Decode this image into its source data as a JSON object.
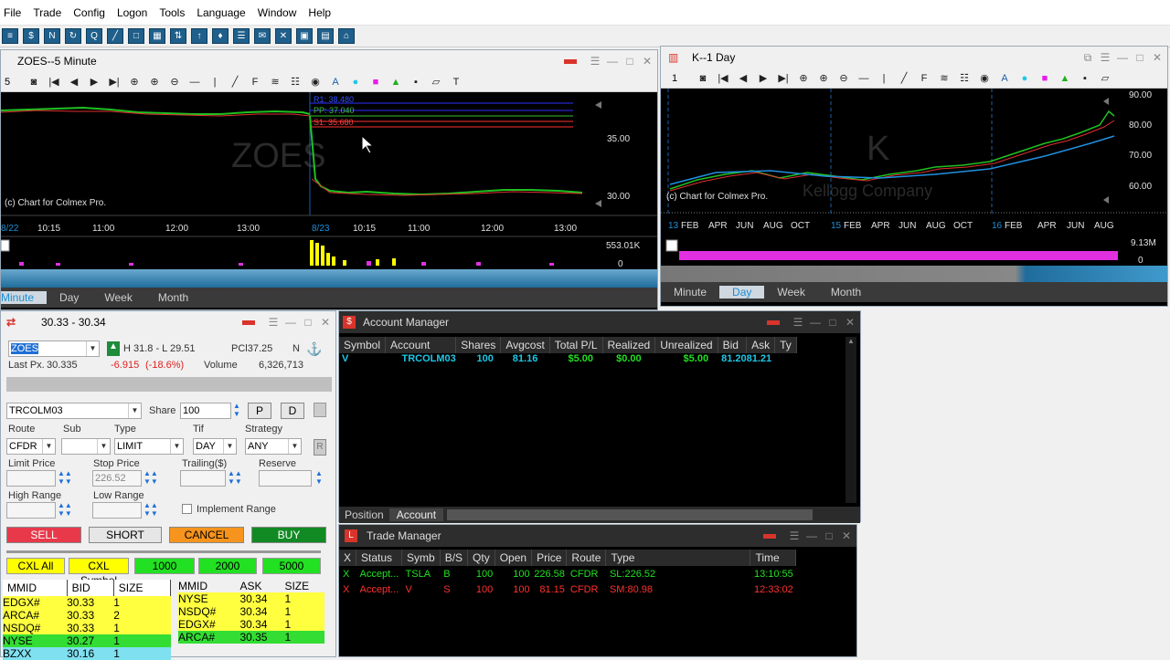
{
  "menu": [
    "File",
    "Trade",
    "Config",
    "Logon",
    "Tools",
    "Language",
    "Window",
    "Help"
  ],
  "toolbar_icons": [
    "layout-icon",
    "dollar-icon",
    "news-icon",
    "refresh-icon",
    "quote-icon",
    "chart-icon",
    "window-icon",
    "grid-icon",
    "sort-icon",
    "upload-icon",
    "alert-icon",
    "list-icon",
    "mail-icon",
    "cross-icon",
    "scan-icon",
    "book-icon",
    "home-icon"
  ],
  "zoes_chart": {
    "title": "ZOES--5 Minute",
    "period_value": "5",
    "watermark": "ZOES",
    "copyright": "(c) Chart for Colmex Pro.",
    "price_ticks": [
      "35.00",
      "30.00"
    ],
    "vol_ticks": [
      "553.01K",
      "0"
    ],
    "lines": [
      "R1: 38.480",
      "PP: 37.040",
      "S1: 35.680"
    ],
    "time_labels": [
      "8/22",
      "10:15",
      "11:00",
      "12:00",
      "13:00",
      "8/23",
      "10:15",
      "11:00",
      "12:00",
      "13:00"
    ],
    "tabs": [
      "Minute",
      "Day",
      "Week",
      "Month"
    ],
    "active_tab": "Minute"
  },
  "k_chart": {
    "title": "K--1 Day",
    "period_value": "1",
    "watermark": "K",
    "company": "Kellogg Company",
    "copyright": "(c) Chart for Colmex Pro.",
    "price_ticks": [
      "90.00",
      "80.00",
      "70.00",
      "60.00"
    ],
    "vol_ticks": [
      "9.13M",
      "0"
    ],
    "time_labels": [
      "13",
      "FEB",
      "APR",
      "JUN",
      "AUG",
      "OCT",
      "15",
      "FEB",
      "APR",
      "JUN",
      "AUG",
      "OCT",
      "16",
      "FEB",
      "APR",
      "JUN",
      "AUG"
    ],
    "tabs": [
      "Minute",
      "Day",
      "Week",
      "Month"
    ],
    "active_tab": "Day"
  },
  "order_entry": {
    "title": "30.33 - 30.34",
    "symbol": "ZOES",
    "high_low": "H 31.8 - L 29.51",
    "pcl": "PCl37.25",
    "n": "N",
    "last_px_label": "Last Px.",
    "last_px": "30.335",
    "change": "-6.915",
    "change_pct": "(-18.6%)",
    "volume_label": "Volume",
    "volume": "6,326,713",
    "account": "TRCOLM03",
    "share_label": "Share",
    "share": "100",
    "p_btn": "P",
    "d_btn": "D",
    "route_label": "Route",
    "route": "CFDR",
    "sub_label": "Sub",
    "sub": "",
    "type_label": "Type",
    "type": "LIMIT",
    "tif_label": "Tif",
    "tif": "DAY",
    "strategy_label": "Strategy",
    "strategy": "ANY",
    "r_btn": "R",
    "limit_price_label": "Limit Price",
    "stop_price_label": "Stop Price",
    "stop_price": "226.52",
    "trailing_label": "Trailing($)",
    "reserve_label": "Reserve",
    "high_range_label": "High Range",
    "low_range_label": "Low Range",
    "implement_range": "Implement Range",
    "sell": "SELL",
    "short": "SHORT",
    "cancel": "CANCEL",
    "buy": "BUY",
    "cxl_all": "CXL All",
    "cxl_symbol": "CXL Symbol",
    "q1": "1000",
    "q2": "2000",
    "q3": "5000",
    "bid_headers": [
      "MMID",
      "BID",
      "SIZE"
    ],
    "ask_headers": [
      "MMID",
      "ASK",
      "SIZE"
    ],
    "bids": [
      [
        "EDGX#",
        "30.33",
        "1"
      ],
      [
        "ARCA#",
        "30.33",
        "2"
      ],
      [
        "NSDQ#",
        "30.33",
        "1"
      ],
      [
        "NYSE",
        "30.27",
        "1"
      ],
      [
        "BZXX",
        "30.16",
        "1"
      ]
    ],
    "asks": [
      [
        "NYSE",
        "30.34",
        "1"
      ],
      [
        "NSDQ#",
        "30.34",
        "1"
      ],
      [
        "EDGX#",
        "30.34",
        "1"
      ],
      [
        "ARCA#",
        "30.35",
        "1"
      ]
    ]
  },
  "account_manager": {
    "title": "Account Manager",
    "headers": [
      "Symbol",
      "Account",
      "Shares",
      "Avgcost",
      "Total P/L",
      "Realized",
      "Unrealized",
      "Bid",
      "Ask",
      "Ty"
    ],
    "row": [
      "V",
      "TRCOLM03",
      "100",
      "81.16",
      "$5.00",
      "$0.00",
      "$5.00",
      "81.20",
      "81.21",
      ""
    ],
    "tabs": [
      "Position",
      "Account"
    ]
  },
  "trade_manager": {
    "title": "Trade Manager",
    "headers": [
      "X",
      "Status",
      "Symb",
      "B/S",
      "Qty",
      "Open",
      "Price",
      "Route",
      "Type",
      "Time"
    ],
    "rows": [
      [
        "X",
        "Accept...",
        "TSLA",
        "B",
        "100",
        "100",
        "226.58",
        "CFDR",
        "SL:226.52",
        "13:10:55"
      ],
      [
        "X",
        "Accept...",
        "V",
        "S",
        "100",
        "100",
        "81.15",
        "CFDR",
        "SM:80.98",
        "12:33:02"
      ]
    ]
  },
  "colors": {
    "blue": "#1e8fd6",
    "green": "#00c000",
    "red": "#e02020",
    "yellow": "#ffff00"
  }
}
